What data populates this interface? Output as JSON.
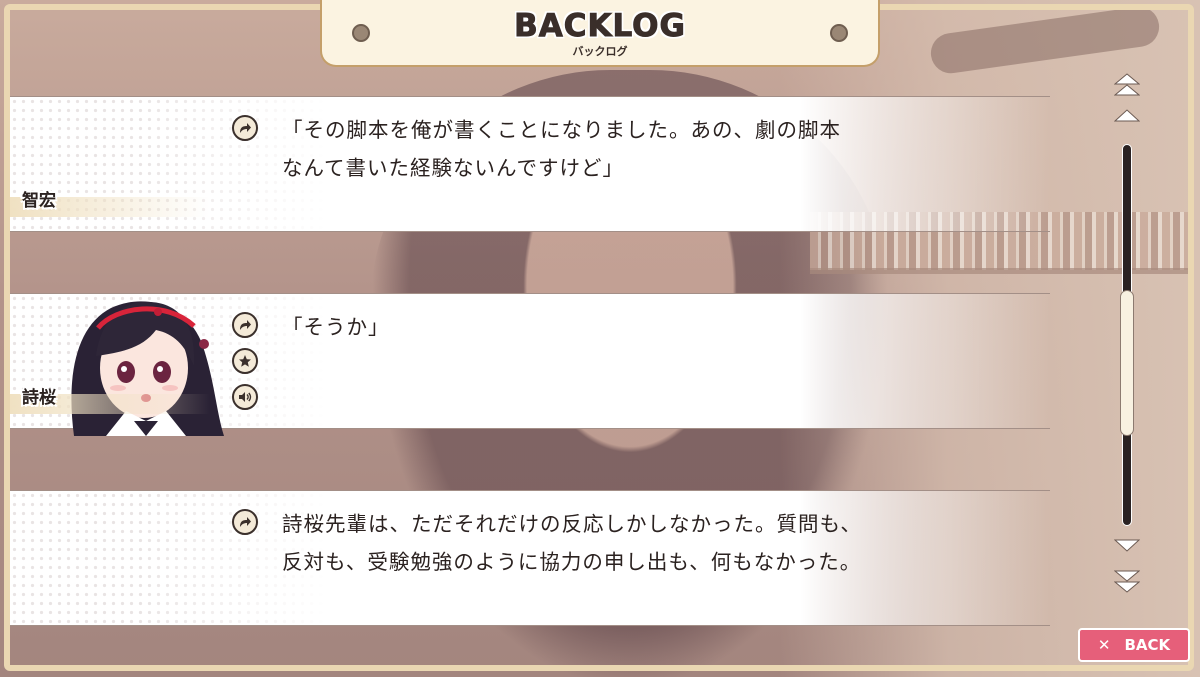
{
  "header": {
    "title": "BACKLOG",
    "subtitle": "バックログ"
  },
  "entries": [
    {
      "speaker": "智宏",
      "text": "「その脚本を俺が書くことになりました。あの、劇の脚本\nなんて書いた経験ないんですけど」",
      "buttons": [
        "jump-icon"
      ]
    },
    {
      "speaker": "詩桜",
      "text": "「そうか」",
      "buttons": [
        "jump-icon",
        "star-icon",
        "voice-icon"
      ]
    },
    {
      "speaker": "",
      "text": "詩桜先輩は、ただそれだけの反応しかしなかった。質問も、\n反対も、受験勉強のように協力の申し出も、何もなかった。",
      "buttons": [
        "jump-icon"
      ]
    }
  ],
  "scrollbar": {
    "position": 0.62
  },
  "back_button": {
    "label": "BACK",
    "icon": "close-icon"
  },
  "colors": {
    "accent": "#e65f7a",
    "frame": "#ead7b2",
    "header_border": "#c49f6a"
  }
}
